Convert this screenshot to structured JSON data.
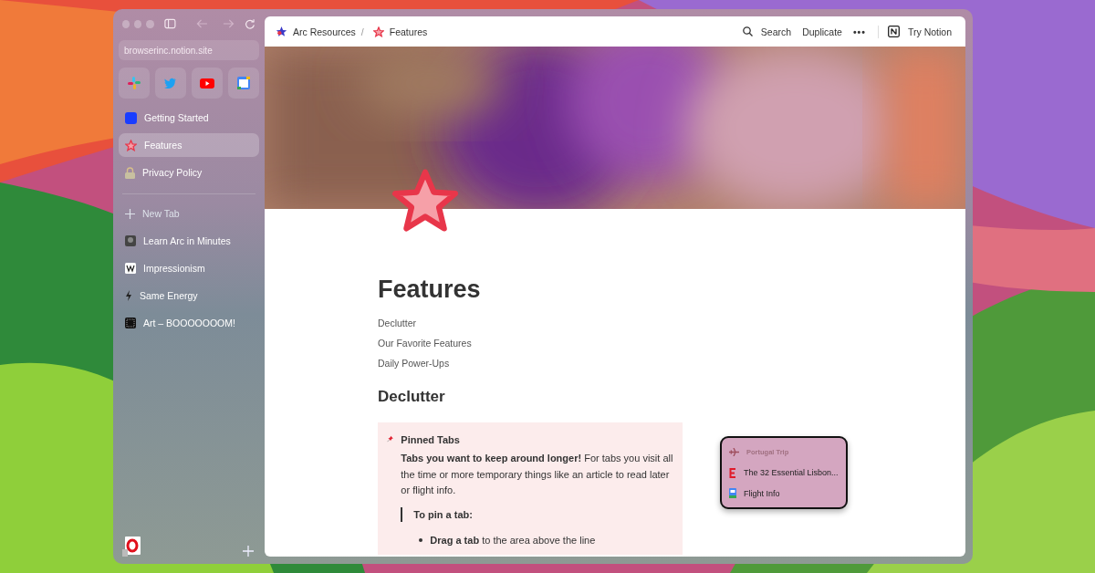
{
  "sidebar": {
    "address": "browserinc.notion.site",
    "pinned": [
      {
        "label": "Getting Started",
        "selected": false
      },
      {
        "label": "Features",
        "selected": true
      },
      {
        "label": "Privacy Policy",
        "selected": false
      }
    ],
    "new_tab": "New Tab",
    "tabs": [
      {
        "label": "Learn Arc in Minutes"
      },
      {
        "label": "Impressionism"
      },
      {
        "label": "Same Energy"
      },
      {
        "label": "Art – BOOOOOOOM!"
      }
    ]
  },
  "topbar": {
    "breadcrumbs": [
      "Arc Resources",
      "Features"
    ],
    "separator": "/",
    "actions": [
      "Search",
      "Duplicate"
    ],
    "more": "•••",
    "try": "Try Notion"
  },
  "page": {
    "title": "Features",
    "toc": [
      "Declutter",
      "Our Favorite Features",
      "Daily Power-Ups"
    ],
    "heading": "Declutter",
    "callout": {
      "title": "Pinned Tabs",
      "body": "**Tabs you want to keep around longer!** For tabs you visit all the time or more temporary things like an article to read later or flight info.",
      "quote": "To pin a tab:",
      "bullets": [
        "**Drag a tab** to the area above the line"
      ]
    }
  },
  "folder_card": {
    "title": "Portugal Trip",
    "items": [
      "The 32 Essential Lisbon...",
      "Flight Info"
    ]
  }
}
